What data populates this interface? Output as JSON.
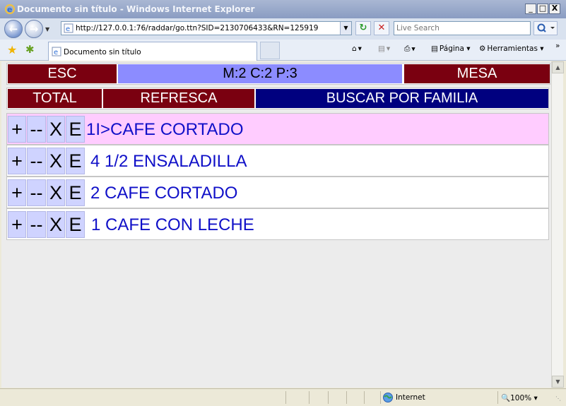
{
  "window": {
    "title": "Documento sin título - Windows Internet Explorer",
    "minimize": "_",
    "maximize": "□",
    "close": "X"
  },
  "nav": {
    "url": "http://127.0.0.1:76/raddar/go.ttn?SID=2130706433&RN=125919",
    "search_placeholder": "Live Search"
  },
  "tabs": [
    {
      "label": "Documento sin título"
    }
  ],
  "toolbar": {
    "page_label": "Página",
    "tools_label": "Herramientas"
  },
  "page": {
    "top_bar": {
      "esc": "ESC",
      "status": "M:2 C:2 P:3",
      "mesa": "MESA"
    },
    "second_bar": {
      "total": "TOTAL",
      "refresca": "REFRESCA",
      "buscar": "BUSCAR POR FAMILIA"
    },
    "row_actions": {
      "plus": "+",
      "minus": "--",
      "delete": "X",
      "edit": "E"
    },
    "items": [
      {
        "text": "1I>CAFE CORTADO",
        "selected": true
      },
      {
        "text": "4 1/2 ENSALADILLA",
        "selected": false
      },
      {
        "text": "2 CAFE CORTADO",
        "selected": false
      },
      {
        "text": "1 CAFE CON LECHE",
        "selected": false
      }
    ],
    "colors": {
      "dark_red": "#7a0010",
      "lavender": "#8c8cff",
      "navy": "#00007f",
      "selected_row": "#ffccff",
      "item_text": "#1010c8"
    }
  },
  "status": {
    "zone": "Internet",
    "zoom": "100%"
  }
}
